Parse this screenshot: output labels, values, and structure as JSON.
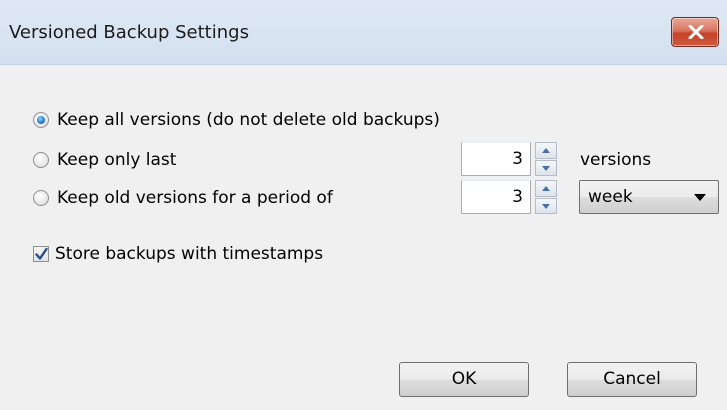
{
  "window": {
    "title": "Versioned Backup Settings"
  },
  "options": {
    "keep_all_label": "Keep all versions (do not delete old backups)",
    "keep_all_selected": true,
    "keep_last_label": "Keep only last",
    "keep_last_selected": false,
    "keep_last_value": "3",
    "keep_last_unit": "versions",
    "keep_period_label": "Keep old versions for a period of",
    "keep_period_selected": false,
    "keep_period_value": "3",
    "keep_period_unit": "week",
    "timestamps_label": "Store backups with timestamps",
    "timestamps_checked": true
  },
  "buttons": {
    "ok_label": "OK",
    "cancel_label": "Cancel"
  },
  "icons": {
    "close": "close-icon",
    "spin_up": "spin-up-arrow-icon",
    "spin_down": "spin-down-arrow-icon",
    "dropdown": "dropdown-arrow-icon",
    "check": "checkmark-icon"
  },
  "colors": {
    "dialog_background": "#f0f0f0",
    "title_bar": "#d9e4f1",
    "close_button": "#c9503a",
    "radio_selected": "#2a7fd1",
    "checkmark": "#2b4c8c"
  }
}
